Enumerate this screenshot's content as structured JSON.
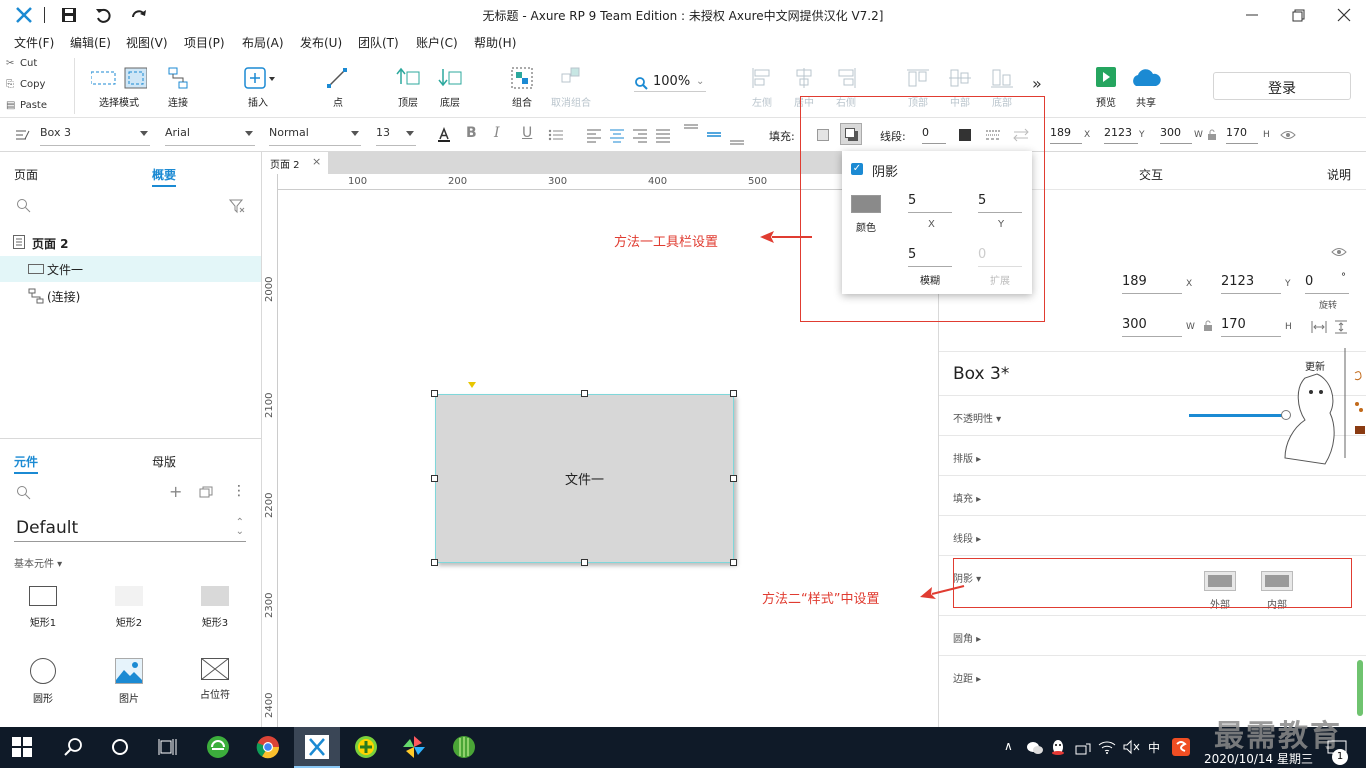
{
  "window": {
    "title": "无标题 - Axure RP 9 Team Edition : 未授权     Axure中文网提供汉化 V7.2]"
  },
  "menu": [
    "文件(F)",
    "编辑(E)",
    "视图(V)",
    "项目(P)",
    "布局(A)",
    "发布(U)",
    "团队(T)",
    "账户(C)",
    "帮助(H)"
  ],
  "clipboard": {
    "cut": "Cut",
    "copy": "Copy",
    "paste": "Paste"
  },
  "toolbar": {
    "select_mode": "选择模式",
    "connect": "连接",
    "insert": "插入",
    "point": "点",
    "top_layer": "顶层",
    "bottom_layer": "底层",
    "group": "组合",
    "ungroup": "取消组合",
    "zoom": "100%",
    "align_left": "左侧",
    "align_center": "居中",
    "align_right": "右侧",
    "align_top": "顶部",
    "align_middle": "中部",
    "align_bottom": "底部",
    "more": "»",
    "preview": "预览",
    "share": "共享",
    "login": "登录"
  },
  "format": {
    "style": "Box 3",
    "font": "Arial",
    "weight": "Normal",
    "size": "13",
    "fill_label": "填充:",
    "line_label": "线段:",
    "line_width": "0",
    "x": "189",
    "y": "2123",
    "w": "300",
    "h": "170",
    "x_suffix": "X",
    "y_suffix": "Y",
    "w_suffix": "W",
    "h_suffix": "H"
  },
  "left": {
    "tabs": {
      "pages": "页面",
      "outline": "概要"
    },
    "tree": {
      "page": "页面 2",
      "item1": "文件一",
      "item2": "(连接)"
    },
    "lib_tabs": {
      "widgets": "元件",
      "masters": "母版"
    },
    "library": "Default",
    "category": "基本元件 ▾",
    "widgets": [
      "矩形1",
      "矩形2",
      "矩形3",
      "圆形",
      "图片",
      "占位符"
    ]
  },
  "canvas": {
    "tab": "页面 2",
    "ruler_x": [
      "100",
      "200",
      "300",
      "400",
      "500"
    ],
    "ruler_y": [
      "2000",
      "2100",
      "2200",
      "2300",
      "2400"
    ],
    "box_label": "文件一"
  },
  "shadow_popup": {
    "title": "阴影",
    "color_label": "颜色",
    "x": "5",
    "x_label": "X",
    "y": "5",
    "y_label": "Y",
    "blur": "5",
    "blur_label": "模糊",
    "spread": "0",
    "spread_label": "扩展"
  },
  "annotations": {
    "method1": "方法一工具栏设置",
    "method2": "方法二“样式”中设置"
  },
  "right": {
    "tabs": {
      "interact": "交互",
      "notes": "说明"
    },
    "x": "189",
    "y": "2123",
    "rotate": "0",
    "rotate_unit": "°",
    "rotate_label": "旋转",
    "w": "300",
    "h": "170",
    "name": "Box 3*",
    "more_text_1": "更新",
    "more_text_2": "创",
    "opacity": "不透明性 ▾",
    "layout": "排版 ▸",
    "fill": "填充 ▸",
    "line": "线段 ▸",
    "shadow": "阴影 ▾",
    "outer": "外部",
    "inner": "内部",
    "corner": "圆角 ▸",
    "padding": "边距 ▸"
  },
  "taskbar": {
    "ime": "中",
    "date": "2020/10/14 星期三",
    "watermark": "最需教育",
    "notif_count": "1"
  },
  "colors": {
    "accent": "#1b8ad3",
    "red": "#e03c31",
    "shape_fill": "#d7d7d7",
    "shape_border": "#7fd7da"
  }
}
